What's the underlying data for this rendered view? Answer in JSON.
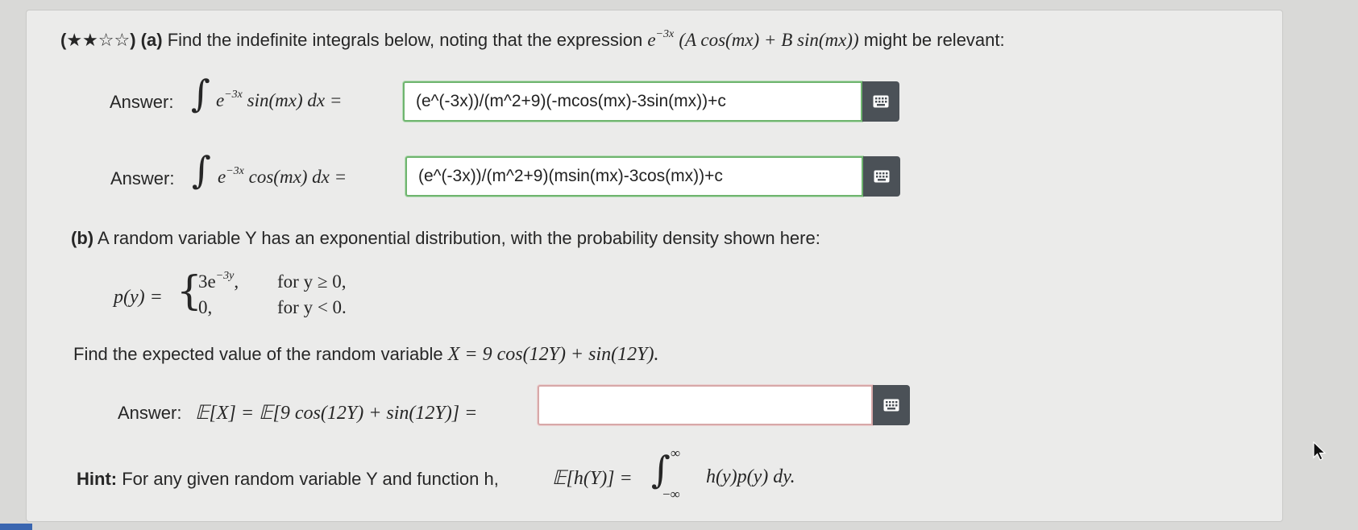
{
  "part_a": {
    "stars": "(★★☆☆)",
    "label": "(a)",
    "text_before": "Find the indefinite integrals below, noting that the expression",
    "expr_e": "e",
    "expr_exp": "−3x",
    "expr_rest": "(A cos(mx) + B sin(mx))",
    "text_after": "might be relevant:"
  },
  "answers": [
    {
      "label": "Answer:",
      "integrand_e": "e",
      "integrand_exp": "−3x",
      "integrand_rest": "sin(mx) dx =",
      "value": "(e^(-3x))/(m^2+9)(-mcos(mx)-3sin(mx))+c"
    },
    {
      "label": "Answer:",
      "integrand_e": "e",
      "integrand_exp": "−3x",
      "integrand_rest": "cos(mx) dx =",
      "value": "(e^(-3x))/(m^2+9)(msin(mx)-3cos(mx))+c"
    }
  ],
  "part_b": {
    "label": "(b)",
    "text": "A random variable Y has an exponential distribution, with the probability density shown here:",
    "pdf_lhs": "p(y) =",
    "case1_value": "3e",
    "case1_exp": "−3y",
    "case1_cond": "for y ≥ 0,",
    "case2_value": "0,",
    "case2_cond": "for y < 0.",
    "find_text": "Find the expected value of the random variable",
    "find_expr": "X = 9 cos(12Y) + sin(12Y).",
    "answer_label": "Answer:",
    "answer_expr": "𝔼[X] = 𝔼[9 cos(12Y) + sin(12Y)] =",
    "answer_value": ""
  },
  "hint": {
    "label": "Hint:",
    "text": "For any given random variable Y and function h,",
    "expr_lhs": "𝔼[h(Y)] =",
    "upper": "∞",
    "lower": "−∞",
    "integrand": "h(y)p(y) dy."
  },
  "icons": {
    "keyboard": "keyboard-icon",
    "cursor": "mouse-cursor-icon"
  },
  "colors": {
    "correct_border": "#6fb56f",
    "empty_border": "#d7a8a8",
    "keypad_button": "#4b5157",
    "card_background": "#ebebea"
  }
}
